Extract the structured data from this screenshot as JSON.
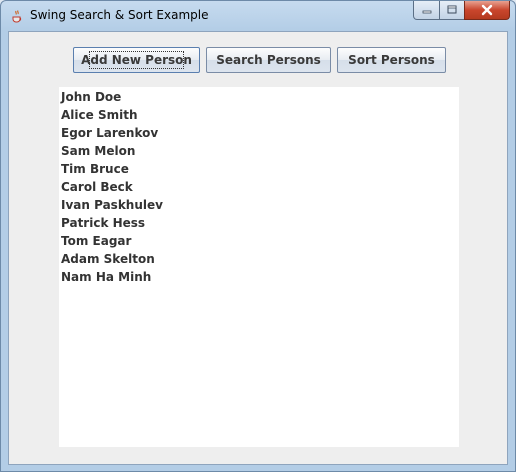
{
  "window": {
    "title": "Swing Search & Sort Example",
    "icon": "java-coffee-icon"
  },
  "toolbar": {
    "add_label": "Add New Person",
    "search_label": "Search Persons",
    "sort_label": "Sort Persons"
  },
  "persons": [
    "John Doe",
    "Alice Smith",
    "Egor Larenkov",
    "Sam Melon",
    "Tim Bruce",
    "Carol Beck",
    "Ivan Paskhulev",
    "Patrick Hess",
    "Tom Eagar",
    "Adam Skelton",
    "Nam Ha Minh"
  ]
}
